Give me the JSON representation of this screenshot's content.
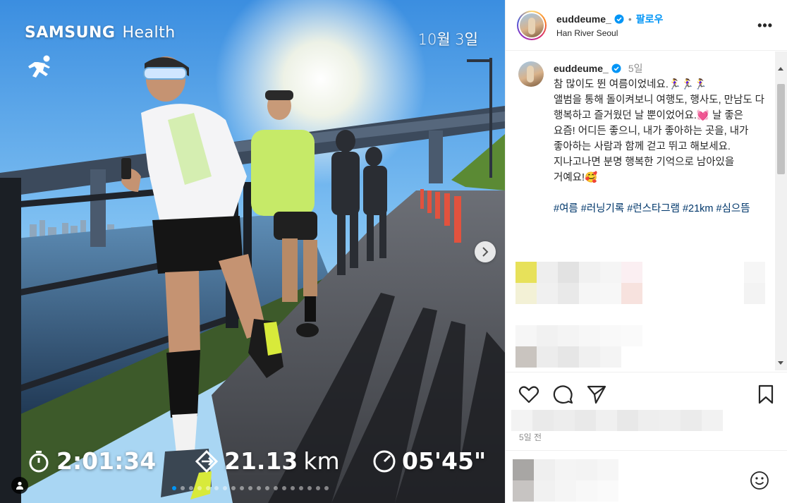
{
  "media": {
    "brand_left": "SAMSUNG",
    "brand_right": "Health",
    "date": "10월 3일",
    "stats": {
      "duration": "2:01:34",
      "distance": "21.13",
      "distance_unit": "km",
      "pace": "05'45\""
    },
    "carousel_dots": 19,
    "carousel_active_index": 0
  },
  "post": {
    "username": "euddeume_",
    "follow_label": "팔로우",
    "separator": "•",
    "location": "Han River Seoul",
    "more_label": "•••",
    "caption_age": "5일",
    "caption_text": "참 많이도 뛴 여름이었네요.🏃‍♀️🏃‍♀️🏃‍♀️\n앨범을 통해 돌이켜보니 여행도, 행사도, 만남도 다 행복하고 즐거웠던 날 뿐이었어요.💓 날 좋은 요즘! 어디든 좋으니, 내가 좋아하는 곳을, 내가 좋아하는 사람과 함께 걷고 뛰고 해보세요. 지나고나면 분명 행복한 기억으로 남아있을 거예요!🥰",
    "hashtags": [
      "#여름",
      "#러닝기록",
      "#런스타그램",
      "#21km",
      "#심으뜸"
    ],
    "time_ago": "5일 전"
  },
  "icons": {
    "like": "heart-icon",
    "comment": "comment-icon",
    "share": "paper-plane-icon",
    "save": "bookmark-icon",
    "emoji": "smiley-icon",
    "verified": "verified-badge-icon",
    "next": "chevron-right-icon"
  },
  "colors": {
    "link_blue": "#0095f6",
    "hashtag": "#00376b",
    "muted": "#8e8e8e",
    "verified_blue": "#0095f6"
  }
}
